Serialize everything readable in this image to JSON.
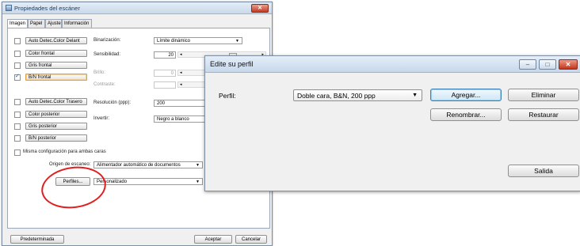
{
  "scanner": {
    "title": "Propiedades del escáner",
    "close": "✕",
    "tabs": [
      "Imagen",
      "Papel",
      "Ajuste",
      "Información"
    ],
    "image_types": [
      {
        "label": "Auto Detec.Color Delant",
        "checked": false
      },
      {
        "label": "Color frontal",
        "checked": false
      },
      {
        "label": "Gris frontal",
        "checked": false
      },
      {
        "label": "B/N frontal",
        "checked": true
      },
      {
        "label": "Auto Detec.Color Trasero",
        "checked": false
      },
      {
        "label": "Color posterior",
        "checked": false
      },
      {
        "label": "Gris posterior",
        "checked": false
      },
      {
        "label": "B/N posterior",
        "checked": false
      }
    ],
    "binarizacion_label": "Binarización:",
    "binarizacion_value": "Límite dinámico",
    "sensibilidad_label": "Sensibilidad:",
    "sensibilidad_value": "20",
    "brillo_label": "Brillo:",
    "brillo_value": "0",
    "contraste_label": "Contraste:",
    "resolucion_label": "Resolución (ppp):",
    "resolucion_value": "200",
    "invertir_label": "Invertir:",
    "invertir_value": "Negro a blanco",
    "misma_config": "Misma configuración para ambas caras",
    "origen_label": "Origen de escaneo:",
    "origen_value": "Alimentador automático de documentos",
    "perfiles_button": "Perfiles...",
    "perfiles_value": "Personalizado",
    "predeterminada": "Predeterminada",
    "aceptar": "Aceptar",
    "cancelar": "Cancelar"
  },
  "profile_dialog": {
    "title": "Edite su perfil",
    "minimize": "–",
    "maximize": "□",
    "close": "✕",
    "perfil_label": "Perfil:",
    "perfil_value": "Doble cara, B&N, 200 ppp",
    "agregar": "Agregar...",
    "eliminar": "Eliminar",
    "renombrar": "Renombrar...",
    "restaurar": "Restaurar",
    "salida": "Salida"
  }
}
